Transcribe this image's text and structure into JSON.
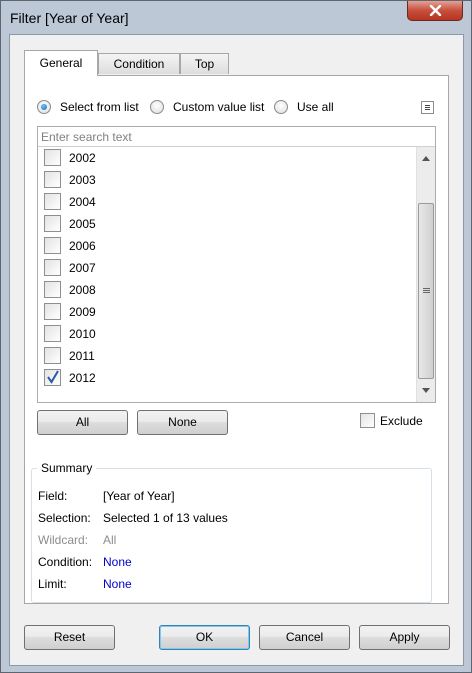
{
  "window": {
    "title": "Filter [Year of Year]"
  },
  "tabs": [
    {
      "label": "General",
      "active": true
    },
    {
      "label": "Condition",
      "active": false
    },
    {
      "label": "Top",
      "active": false
    }
  ],
  "mode_options": [
    {
      "label": "Select from list",
      "selected": true
    },
    {
      "label": "Custom value list",
      "selected": false
    },
    {
      "label": "Use all",
      "selected": false
    }
  ],
  "search": {
    "placeholder": "Enter search text",
    "value": ""
  },
  "list": {
    "items": [
      {
        "label": "2002",
        "checked": false
      },
      {
        "label": "2003",
        "checked": false
      },
      {
        "label": "2004",
        "checked": false
      },
      {
        "label": "2005",
        "checked": false
      },
      {
        "label": "2006",
        "checked": false
      },
      {
        "label": "2007",
        "checked": false
      },
      {
        "label": "2008",
        "checked": false
      },
      {
        "label": "2009",
        "checked": false
      },
      {
        "label": "2010",
        "checked": false
      },
      {
        "label": "2011",
        "checked": false
      },
      {
        "label": "2012",
        "checked": true
      }
    ]
  },
  "buttons": {
    "all": "All",
    "none": "None"
  },
  "exclude": {
    "label": "Exclude",
    "checked": false
  },
  "summary": {
    "title": "Summary",
    "rows": [
      {
        "key": "Field:",
        "value": "[Year of Year]",
        "style": "normal"
      },
      {
        "key": "Selection:",
        "value": "Selected 1 of 13 values",
        "style": "normal"
      },
      {
        "key": "Wildcard:",
        "value": "All",
        "style": "disabled"
      },
      {
        "key": "Condition:",
        "value": "None",
        "style": "link"
      },
      {
        "key": "Limit:",
        "value": "None",
        "style": "link"
      }
    ]
  },
  "footer": {
    "reset": "Reset",
    "ok": "OK",
    "cancel": "Cancel",
    "apply": "Apply"
  },
  "colors": {
    "accent": "#1a62b9",
    "link": "#0000c8",
    "check": "#2b57a7"
  }
}
